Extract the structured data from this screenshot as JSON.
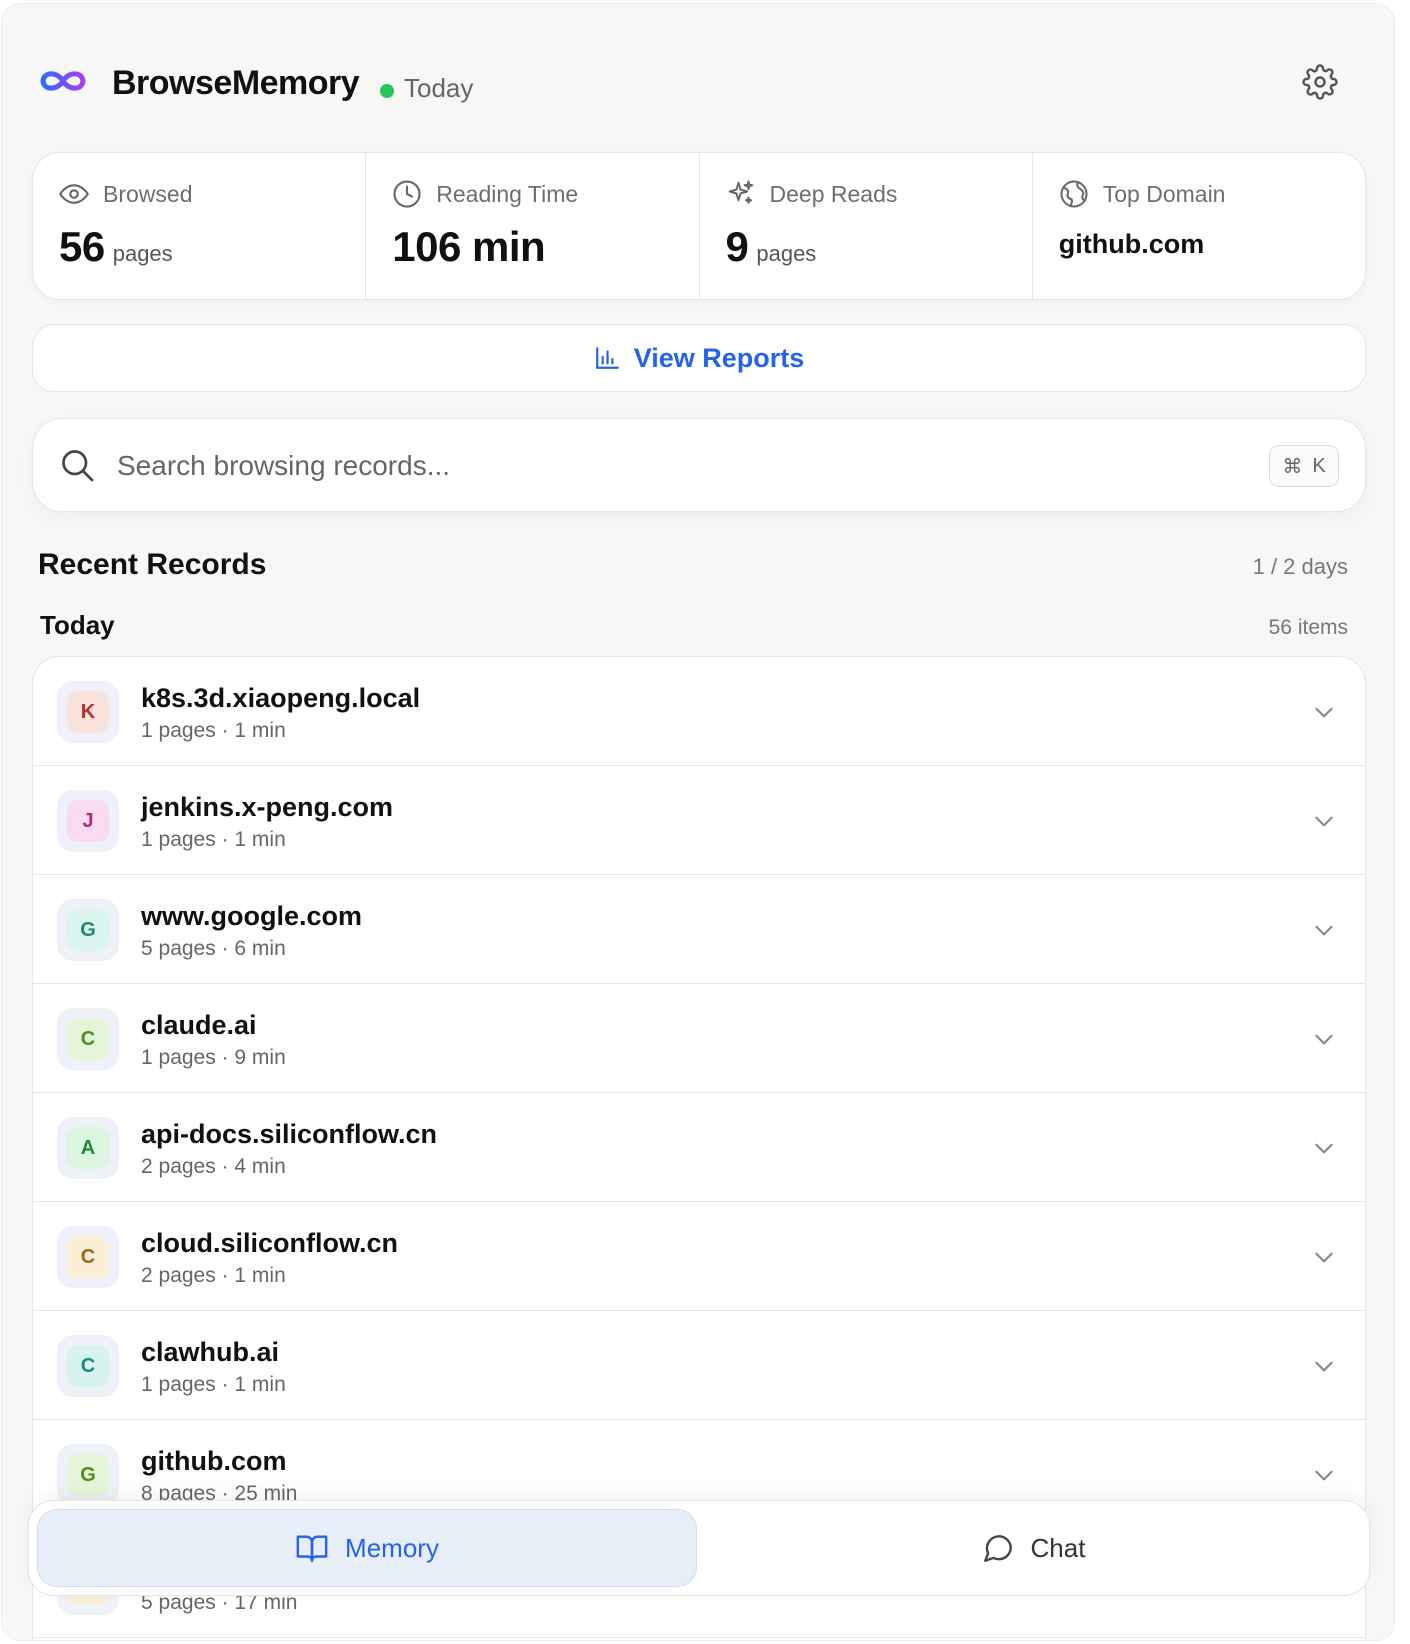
{
  "app": {
    "title": "BrowseMemory",
    "status": "Today"
  },
  "stats": [
    {
      "icon": "eye-icon",
      "label": "Browsed",
      "value": "56",
      "unit": "pages"
    },
    {
      "icon": "clock-icon",
      "label": "Reading Time",
      "value": "106 min",
      "unit": ""
    },
    {
      "icon": "sparkle-icon",
      "label": "Deep Reads",
      "value": "9",
      "unit": "pages"
    },
    {
      "icon": "globe-icon",
      "label": "Top Domain",
      "value": "github.com",
      "unit": ""
    }
  ],
  "reports": {
    "label": "View Reports",
    "icon": "bar-chart-icon"
  },
  "search": {
    "placeholder": "Search browsing records...",
    "shortcut_symbol": "⌘",
    "shortcut_key": "K"
  },
  "recent": {
    "title": "Recent Records",
    "meta": "1 / 2 days"
  },
  "group": {
    "title": "Today",
    "meta": "56 items"
  },
  "records": [
    {
      "letter": "K",
      "domain": "k8s.3d.xiaopeng.local",
      "meta": "1 pages · 1 min",
      "bg": "#fbe1de",
      "fg": "#b3312b"
    },
    {
      "letter": "J",
      "domain": "jenkins.x-peng.com",
      "meta": "1 pages · 1 min",
      "bg": "#f8dcee",
      "fg": "#b3267f"
    },
    {
      "letter": "G",
      "domain": "www.google.com",
      "meta": "5 pages · 6 min",
      "bg": "#dcf4ee",
      "fg": "#1f8a6b"
    },
    {
      "letter": "C",
      "domain": "claude.ai",
      "meta": "1 pages · 9 min",
      "bg": "#e5f6d8",
      "fg": "#4d8f1f"
    },
    {
      "letter": "A",
      "domain": "api-docs.siliconflow.cn",
      "meta": "2 pages · 4 min",
      "bg": "#dcf5e0",
      "fg": "#1e8a3a"
    },
    {
      "letter": "C",
      "domain": "cloud.siliconflow.cn",
      "meta": "2 pages · 1 min",
      "bg": "#fbeed6",
      "fg": "#a0651a"
    },
    {
      "letter": "C",
      "domain": "clawhub.ai",
      "meta": "1 pages · 1 min",
      "bg": "#d8f3ef",
      "fg": "#1a8c7c"
    },
    {
      "letter": "G",
      "domain": "github.com",
      "meta": "8 pages · 25 min",
      "bg": "#e5f6d8",
      "fg": "#4d8f1f"
    },
    {
      "letter": "",
      "domain": "",
      "meta": "5 pages · 17 min",
      "bg": "#fbeed6",
      "fg": "#a0651a"
    }
  ],
  "nav": {
    "memory": {
      "label": "Memory",
      "icon": "book-icon"
    },
    "chat": {
      "label": "Chat",
      "icon": "chat-bubble-icon"
    }
  },
  "colors": {
    "accent": "#2563eb",
    "status": "#22c55e"
  }
}
